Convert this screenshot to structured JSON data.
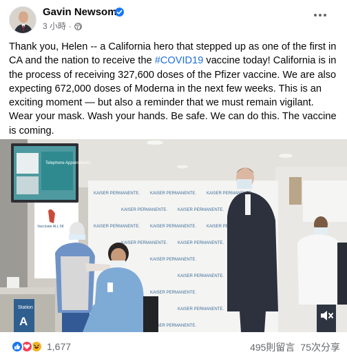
{
  "post": {
    "author": "Gavin Newsom",
    "time": "3 小時",
    "separator": "·",
    "text_before_hashtag": "Thank you, Helen -- a California hero that stepped up as one of the first in CA and the nation to receive the ",
    "hashtag": "#COVID19",
    "text_after_hashtag": " vaccine today! California is in the process of receiving 327,600 doses of the Pfizer vaccine. We are also expecting 672,000 doses of Moderna in the next few weeks. This is an exciting moment — but also a reminder that we must remain vigilant. Wear your mask. Wash your hands. Be safe. We can do this. The vaccine is coming."
  },
  "video": {
    "screen_title": "Telephone Appointments",
    "backdrop_brand": "KAISER PERMANENTE.",
    "sign_text": "Vaccinate ALL 58",
    "station_label": "Station",
    "station_letter": "A",
    "volume_icon": "volume-muted-icon"
  },
  "footer": {
    "reaction_icons": [
      "like-icon",
      "love-icon",
      "haha-icon"
    ],
    "reaction_count": "1,677",
    "comments": "495則留言",
    "shares": "75次分享"
  },
  "colors": {
    "link": "#216fdb",
    "meta_text": "#65676b",
    "like": "#1877f2",
    "love": "#f33e58",
    "haha": "#f7b125"
  }
}
